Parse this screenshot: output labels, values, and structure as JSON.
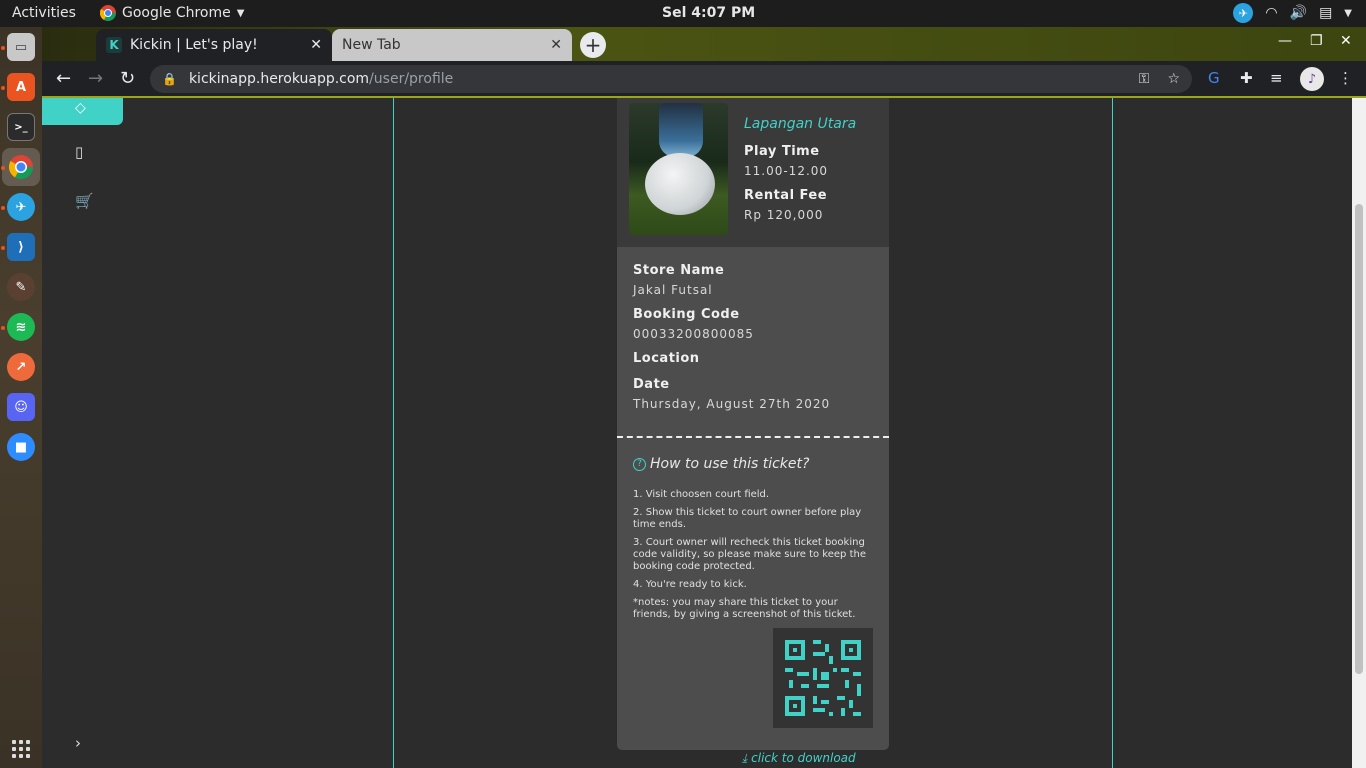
{
  "system": {
    "activities": "Activities",
    "app_name": "Google Chrome",
    "clock": "Sel  4:07 PM"
  },
  "browser": {
    "tabs": [
      {
        "title": "Kickin | Let's play!",
        "favicon": "K"
      },
      {
        "title": "New Tab"
      }
    ],
    "url_host": "kickinapp.herokuapp.com",
    "url_path": "/user/profile"
  },
  "ticket": {
    "field_name": "Lapangan Utara",
    "play_time_label": "Play Time",
    "play_time": "11.00-12.00",
    "rental_fee_label": "Rental Fee",
    "rental_fee": "Rp 120,000",
    "store_name_label": "Store Name",
    "store_name": "Jakal Futsal",
    "booking_code_label": "Booking Code",
    "booking_code": "00033200800085",
    "location_label": "Location",
    "date_label": "Date",
    "date": "Thursday, August 27th 2020",
    "howto_title": "How to use this ticket?",
    "steps": [
      "1. Visit choosen court field.",
      "2. Show this ticket to court owner before play time ends.",
      "3. Court owner will recheck this ticket booking code validity, so please make sure to keep the booking code protected.",
      "4. You're ready to kick.",
      "*notes: you may share this ticket to your friends, by giving a screenshot of this ticket."
    ],
    "download_label": "click to download"
  },
  "colors": {
    "accent": "#41d2c7",
    "panel_dark": "#3a3a3a",
    "panel_mid": "#4d4d4d",
    "page_bg": "#2c2c2c"
  }
}
